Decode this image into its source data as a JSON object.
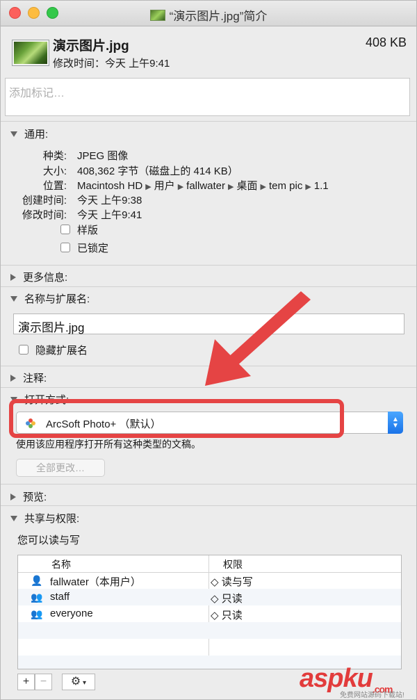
{
  "window": {
    "title": "“演示图片.jpg”简介"
  },
  "header": {
    "file_name": "演示图片.jpg",
    "file_size": "408 KB",
    "modified": "修改时间：今天 上午9:41"
  },
  "tags": {
    "placeholder": "添加标记…"
  },
  "general": {
    "title": "通用:",
    "rows": [
      {
        "label": "种类:",
        "value": "JPEG 图像"
      },
      {
        "label": "大小:",
        "value": "408,362 字节（磁盘上的 414 KB）"
      },
      {
        "label": "位置:",
        "path": [
          "Macintosh HD",
          "用户",
          "fallwater",
          "桌面",
          "tem pic",
          "1.1"
        ]
      },
      {
        "label": "创建时间:",
        "value": "今天 上午9:38"
      },
      {
        "label": "修改时间:",
        "value": "今天 上午9:41"
      }
    ],
    "stationery": "样版",
    "locked": "已锁定"
  },
  "more_info": {
    "title": "更多信息:"
  },
  "name_ext": {
    "title": "名称与扩展名:",
    "filename": "演示图片.jpg",
    "hide_ext": "隐藏扩展名"
  },
  "comments": {
    "title": "注释:"
  },
  "open_with": {
    "title": "打开方式:",
    "app": "ArcSoft Photo+ （默认）",
    "description": "使用该应用程序打开所有这种类型的文稿。",
    "change_all": "全部更改…"
  },
  "preview": {
    "title": "预览:"
  },
  "sharing": {
    "title": "共享与权限:",
    "caption": "您可以读与写",
    "col_name": "名称",
    "col_priv": "权限",
    "rows": [
      {
        "name": "fallwater（本用户）",
        "priv": "读与写",
        "icon": "single-user-icon"
      },
      {
        "name": "staff",
        "priv": "只读",
        "icon": "group-icon"
      },
      {
        "name": "everyone",
        "priv": "只读",
        "icon": "everyone-icon"
      }
    ],
    "stepper": "◇",
    "add": "+",
    "remove": "−",
    "action": "⚙"
  },
  "watermark": {
    "logo": "aspku",
    "suffix": ".com",
    "sub": "免费网站源码下载站!"
  },
  "colors": {
    "highlight": "#e54444",
    "accent": "#1a73e8"
  }
}
